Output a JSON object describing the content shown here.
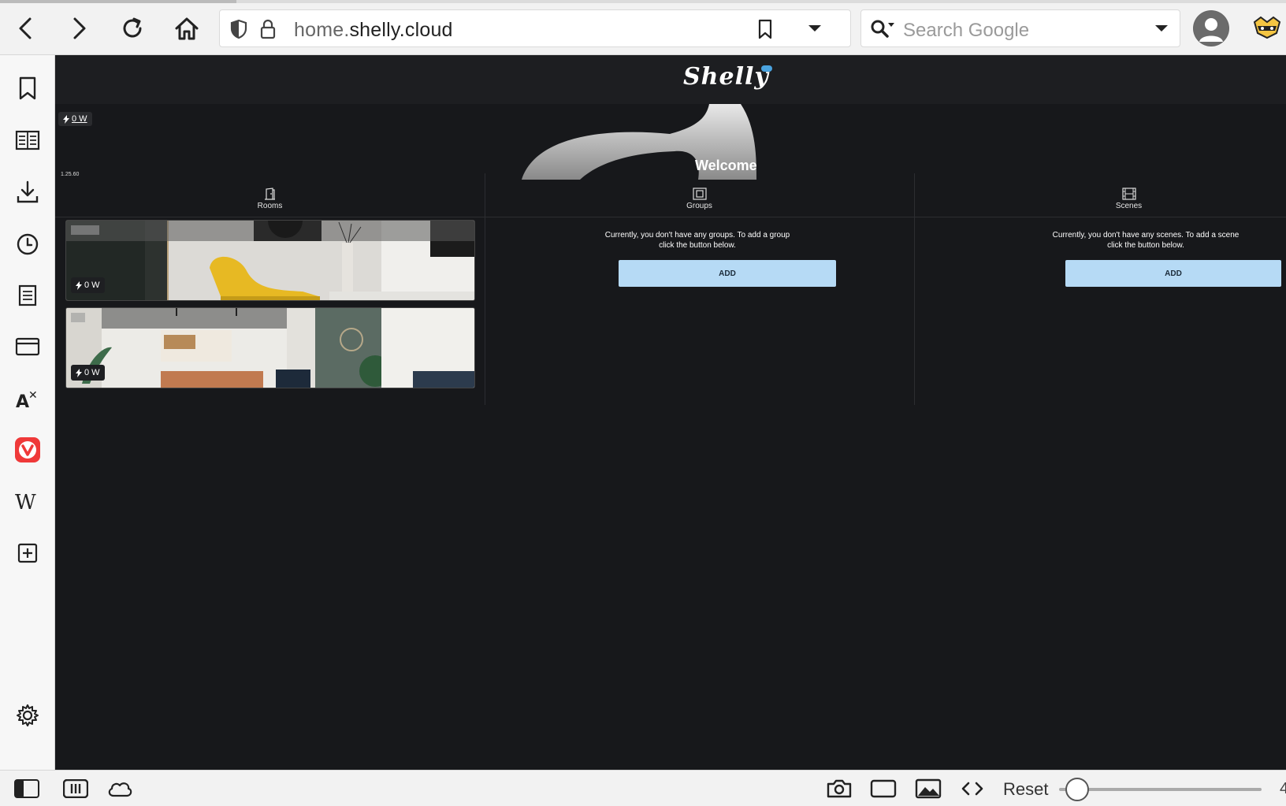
{
  "browser": {
    "url": {
      "host_prefix": "home.",
      "host_main": "shelly.cloud"
    },
    "search": {
      "placeholder": "Search Google"
    }
  },
  "sidepanel": {
    "items": [
      {
        "name": "bookmarks-icon"
      },
      {
        "name": "reading-list-icon"
      },
      {
        "name": "downloads-icon"
      },
      {
        "name": "history-icon"
      },
      {
        "name": "notes-icon"
      },
      {
        "name": "window-panel-icon"
      },
      {
        "name": "translate-icon"
      },
      {
        "name": "vivaldi-icon"
      },
      {
        "name": "wikipedia-icon"
      },
      {
        "name": "add-panel-icon"
      }
    ]
  },
  "shelly": {
    "logo": "Shelly",
    "power_total": "0 W",
    "version": "1.25.60",
    "welcome": "Welcome",
    "tabs": [
      {
        "label": "Rooms",
        "icon": "door-icon"
      },
      {
        "label": "Groups",
        "icon": "groups-icon"
      },
      {
        "label": "Scenes",
        "icon": "film-icon"
      }
    ],
    "rooms": [
      {
        "power": "0 W"
      },
      {
        "power": "0 W"
      }
    ],
    "groups": {
      "empty_message": "Currently, you don't have any groups. To add a group click the button below.",
      "add_label": "ADD"
    },
    "scenes": {
      "empty_message": "Currently, you don't have any scenes. To add a scene click the button below.",
      "add_label": "ADD"
    }
  },
  "statusbar": {
    "reset_label": "Reset",
    "zoom_edge": "4"
  },
  "colors": {
    "content_bg": "#17181b",
    "add_button": "#b6daf5",
    "vivaldi_red": "#ef3939",
    "logo_accent": "#4aa3df"
  }
}
